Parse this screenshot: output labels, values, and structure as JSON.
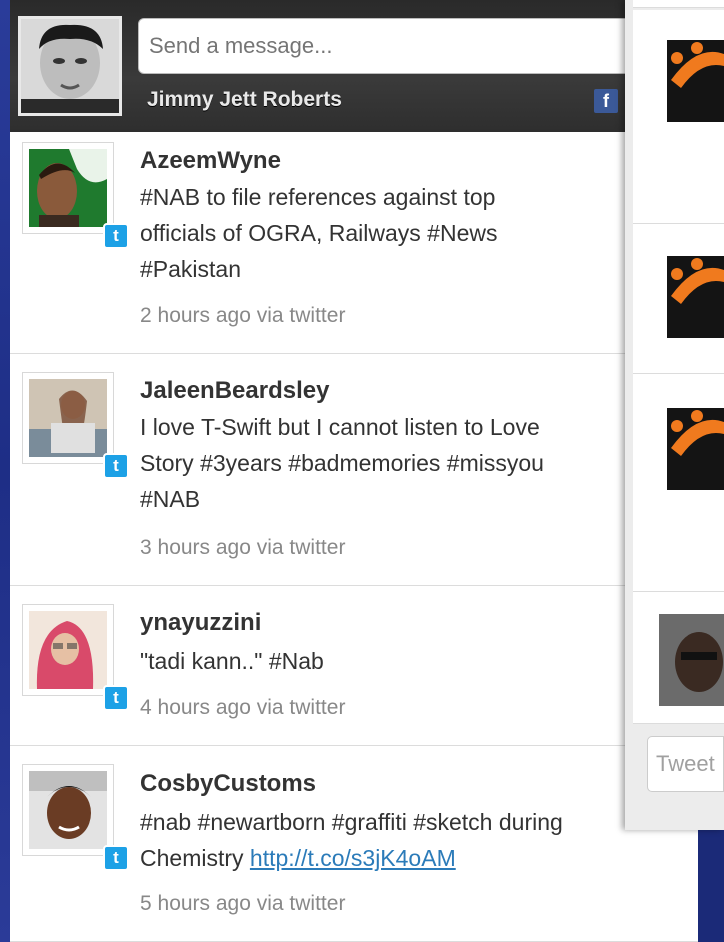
{
  "composer": {
    "placeholder": "Send a message...",
    "user_name": "Jimmy Jett Roberts",
    "facebook_icon": "f"
  },
  "tweets": [
    {
      "username": "AzeemWyne",
      "text": "#NAB to file references against top\nofficials of OGRA, Railways #News\n#Pakistan",
      "meta": "2 hours ago via twitter"
    },
    {
      "username": "JaleenBeardsley",
      "text": "I love T-Swift but I cannot listen to Love\nStory #3years #badmemories #missyou\n#NAB",
      "meta": "3 hours ago via twitter"
    },
    {
      "username": "ynayuzzini",
      "text": "\"tadi kann..\" #Nab",
      "meta": "4 hours ago via twitter"
    },
    {
      "username": "CosbyCustoms",
      "text_prefix": "#nab #newartborn #graffiti #sketch during\nChemistry ",
      "link": "http://t.co/s3jK4oAM",
      "meta": "5 hours ago via twitter"
    }
  ],
  "right_panel": {
    "tweet_placeholder": "Tweet"
  },
  "colors": {
    "background": "#1c2b7a",
    "twitter_blue": "#1da1e6",
    "facebook_blue": "#3b5998",
    "link": "#2b7bb9"
  },
  "icons": {
    "twitter_badge": "twitter-bird-icon",
    "facebook": "facebook-icon"
  }
}
